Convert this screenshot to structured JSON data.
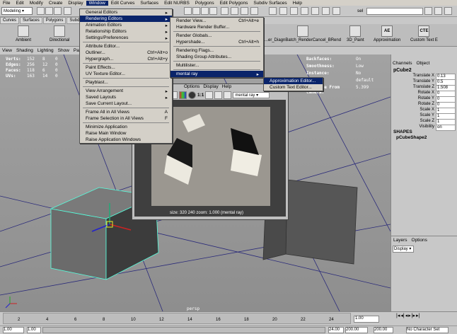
{
  "menubar": [
    "File",
    "Edit",
    "Modify",
    "Create",
    "Display",
    "Window",
    "Edit Curves",
    "Surfaces",
    "Edit NURBS",
    "Polygons",
    "Edit Polygons",
    "Subdiv Surfaces",
    "Help"
  ],
  "status_line": {
    "mode": "Modeling",
    "selection_field": "sel"
  },
  "shelf_tabs": [
    "Curves",
    "Surfaces",
    "Polygons",
    "Subd"
  ],
  "shelf_items": [
    "Ambient",
    "Directional",
    "...er_DiagnBatch_RenderCancel_BRend",
    "3D_Paint",
    "Approximation",
    "Custom Text E"
  ],
  "shelf_item_codes": [
    "AE",
    "CTE"
  ],
  "panel_menu": [
    "View",
    "Shading",
    "Lighting",
    "Show",
    "Panels"
  ],
  "hud_left": [
    {
      "label": "Verts:",
      "a": "152",
      "b": "8",
      "c": "0"
    },
    {
      "label": "Edges:",
      "a": "256",
      "b": "12",
      "c": "0"
    },
    {
      "label": "Faces:",
      "a": "118",
      "b": "6",
      "c": "0"
    },
    {
      "label": "UVs:",
      "a": "163",
      "b": "14",
      "c": "0"
    }
  ],
  "hud_right": [
    {
      "label": "Backfaces:",
      "value": "On"
    },
    {
      "label": "Smoothness:",
      "value": "Low"
    },
    {
      "label": "Instance:",
      "value": "No"
    },
    {
      "label": "Layer:",
      "value": "default"
    },
    {
      "label": "Distance From Camera:",
      "value": "5.399"
    }
  ],
  "viewport_camera": "persp",
  "channels": {
    "menu": [
      "Channels",
      "Object"
    ],
    "object_name": "pCube2",
    "attrs": [
      {
        "name": "Translate X",
        "value": "0.13"
      },
      {
        "name": "Translate Y",
        "value": "0.5"
      },
      {
        "name": "Translate Z",
        "value": "1.508"
      },
      {
        "name": "Rotate X",
        "value": "0"
      },
      {
        "name": "Rotate Y",
        "value": "0"
      },
      {
        "name": "Rotate Z",
        "value": "0"
      },
      {
        "name": "Scale X",
        "value": "1"
      },
      {
        "name": "Scale Y",
        "value": "1"
      },
      {
        "name": "Scale Z",
        "value": "1"
      },
      {
        "name": "Visibility",
        "value": "on"
      }
    ],
    "shapes_header": "SHAPES",
    "shape_name": "pCubeShape2"
  },
  "layers": {
    "menu": [
      "Layers",
      "Options"
    ],
    "dropdown": "Display"
  },
  "window_menu": {
    "items": [
      {
        "label": "General Editors",
        "arrow": true
      },
      {
        "label": "Rendering Editors",
        "arrow": true,
        "selected": true
      },
      {
        "label": "Animation Editors",
        "arrow": true
      },
      {
        "label": "Relationship Editors",
        "arrow": true
      },
      {
        "label": "Settings/Preferences",
        "arrow": true
      },
      {
        "sep": true
      },
      {
        "label": "Attribute Editor..."
      },
      {
        "label": "Outliner...",
        "shortcut": "Ctrl+Alt+o"
      },
      {
        "label": "Hypergraph...",
        "shortcut": "Ctrl+Alt+y"
      },
      {
        "sep": true
      },
      {
        "label": "Paint Effects..."
      },
      {
        "label": "UV Texture Editor..."
      },
      {
        "sep": true
      },
      {
        "label": "Playblast..."
      },
      {
        "sep": true
      },
      {
        "label": "View Arrangement",
        "arrow": true
      },
      {
        "label": "Saved Layouts",
        "arrow": true
      },
      {
        "label": "Save Current Layout..."
      },
      {
        "sep": true
      },
      {
        "label": "Frame All in All Views",
        "shortcut": "A"
      },
      {
        "label": "Frame Selection in All Views",
        "shortcut": "F"
      },
      {
        "sep": true
      },
      {
        "label": "Minimize Application"
      },
      {
        "label": "Raise Main Window"
      },
      {
        "label": "Raise Application Windows"
      }
    ]
  },
  "rendering_menu": {
    "items": [
      {
        "label": "Render View...",
        "shortcut": "Ctrl+Alt+e"
      },
      {
        "label": "Hardware Render Buffer..."
      },
      {
        "sep": true
      },
      {
        "label": "Render Globals..."
      },
      {
        "label": "Hypershade...",
        "shortcut": "Ctrl+Alt+h"
      },
      {
        "sep": true
      },
      {
        "label": "Rendering Flags..."
      },
      {
        "label": "Shading Group Attributes..."
      },
      {
        "sep": true
      },
      {
        "label": "Multilister..."
      },
      {
        "sep": true
      },
      {
        "label": "mental ray",
        "arrow": true,
        "selected": true
      }
    ]
  },
  "mentalray_menu": {
    "items": [
      {
        "label": "Approximation Editor...",
        "selected": true
      },
      {
        "label": "Custom Text Editor..."
      }
    ]
  },
  "render_view": {
    "menu": [
      "Options",
      "Display",
      "Help"
    ],
    "ratio": "1:1",
    "renderer": "mental ray",
    "status": "size: 320  240 zoom: 1.000  (mental ray)"
  },
  "time_slider": {
    "ticks": [
      "2",
      "4",
      "6",
      "8",
      "10",
      "12",
      "14",
      "16",
      "18",
      "20",
      "22",
      "24"
    ],
    "current": "1.00"
  },
  "range_slider": {
    "start": "1.00",
    "start2": "1.00",
    "end": "24.00",
    "end2": "200.00",
    "end3": "200.00",
    "character_set": "No Character Set"
  }
}
